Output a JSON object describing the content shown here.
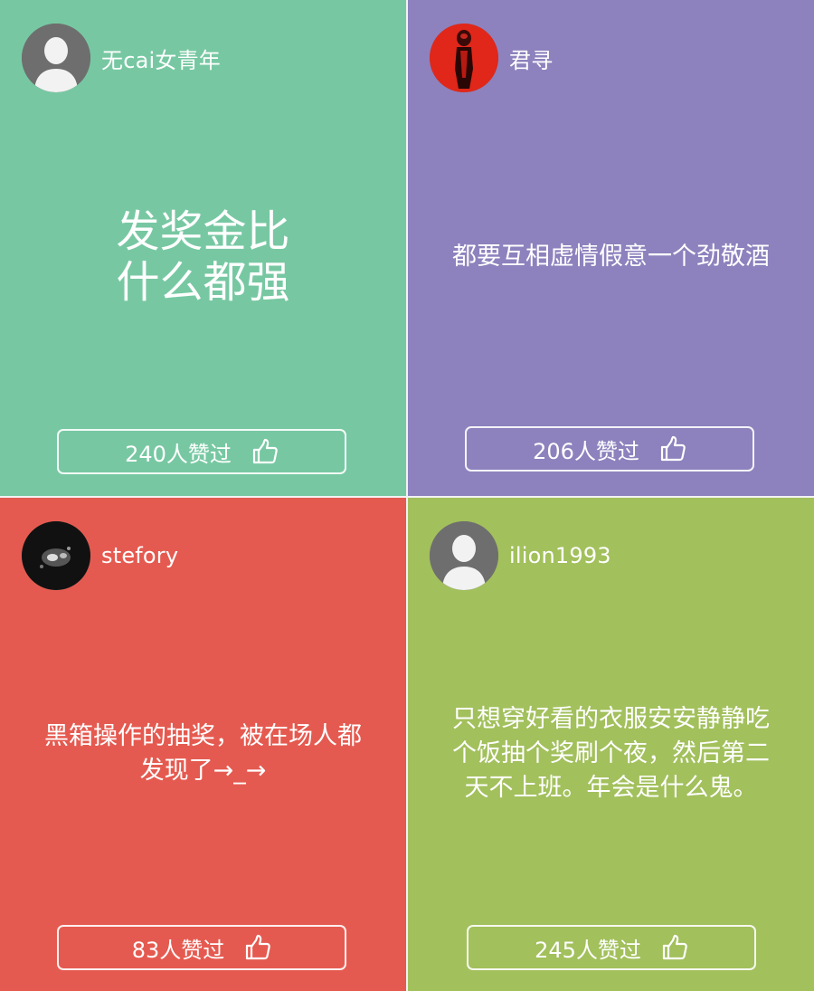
{
  "cards": [
    {
      "bg": "#77c8a2",
      "avatar_icon": "default-user-icon",
      "username": "无cai女青年",
      "content": "发奖金比\n什么都强",
      "likes_text": "240人赞过"
    },
    {
      "bg": "#8d82bd",
      "avatar_icon": "red-figure-photo-avatar",
      "username": "君寻",
      "content": "都要互相虚情假意一个劲敬酒",
      "likes_text": "206人赞过"
    },
    {
      "bg": "#e55a50",
      "avatar_icon": "dark-abstract-photo-avatar",
      "username": "stefory",
      "content": "黑箱操作的抽奖，被在场人都\n发现了→_→",
      "likes_text": "83人赞过"
    },
    {
      "bg": "#a2c05c",
      "avatar_icon": "default-user-icon",
      "username": "ilion1993",
      "content": "只想穿好看的衣服安安静静吃\n个饭抽个奖刷个夜，然后第二\n天不上班。年会是什么鬼。",
      "likes_text": "245人赞过"
    }
  ],
  "like_icon": "thumbs-up-icon"
}
